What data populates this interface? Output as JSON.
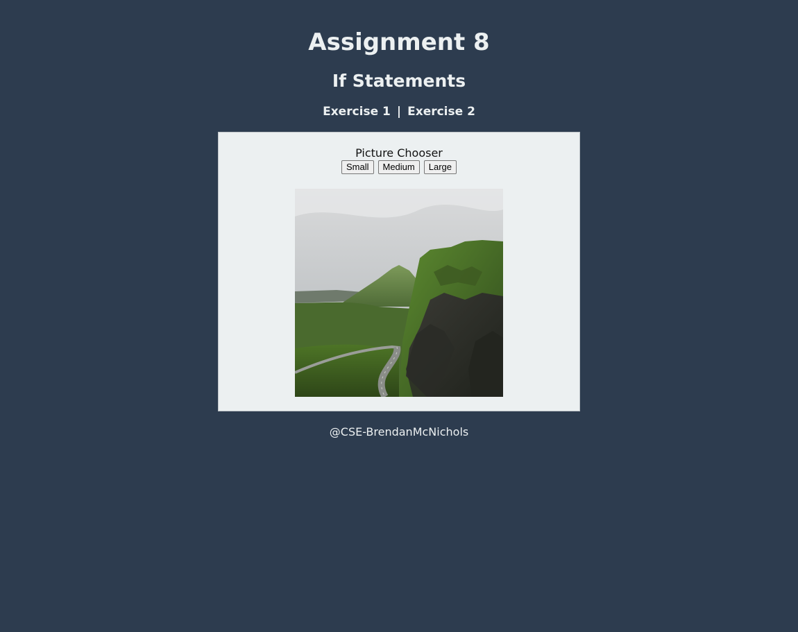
{
  "header": {
    "title": "Assignment 8",
    "subtitle": "If Statements"
  },
  "nav": {
    "links": [
      {
        "label": "Exercise 1"
      },
      {
        "label": "Exercise 2"
      }
    ],
    "separator": "|"
  },
  "chooser": {
    "title": "Picture Chooser",
    "buttons": {
      "small": "Small",
      "medium": "Medium",
      "large": "Large"
    },
    "selected_size": "Medium",
    "image": {
      "subject": "mountain road landscape",
      "icon": "landscape-photo"
    }
  },
  "footer": {
    "credit": "@CSE-BrendanMcNichols"
  },
  "colors": {
    "page_background": "#2d3c4f",
    "panel_background": "#ecf0f1",
    "text_light": "#ecf0f1"
  }
}
